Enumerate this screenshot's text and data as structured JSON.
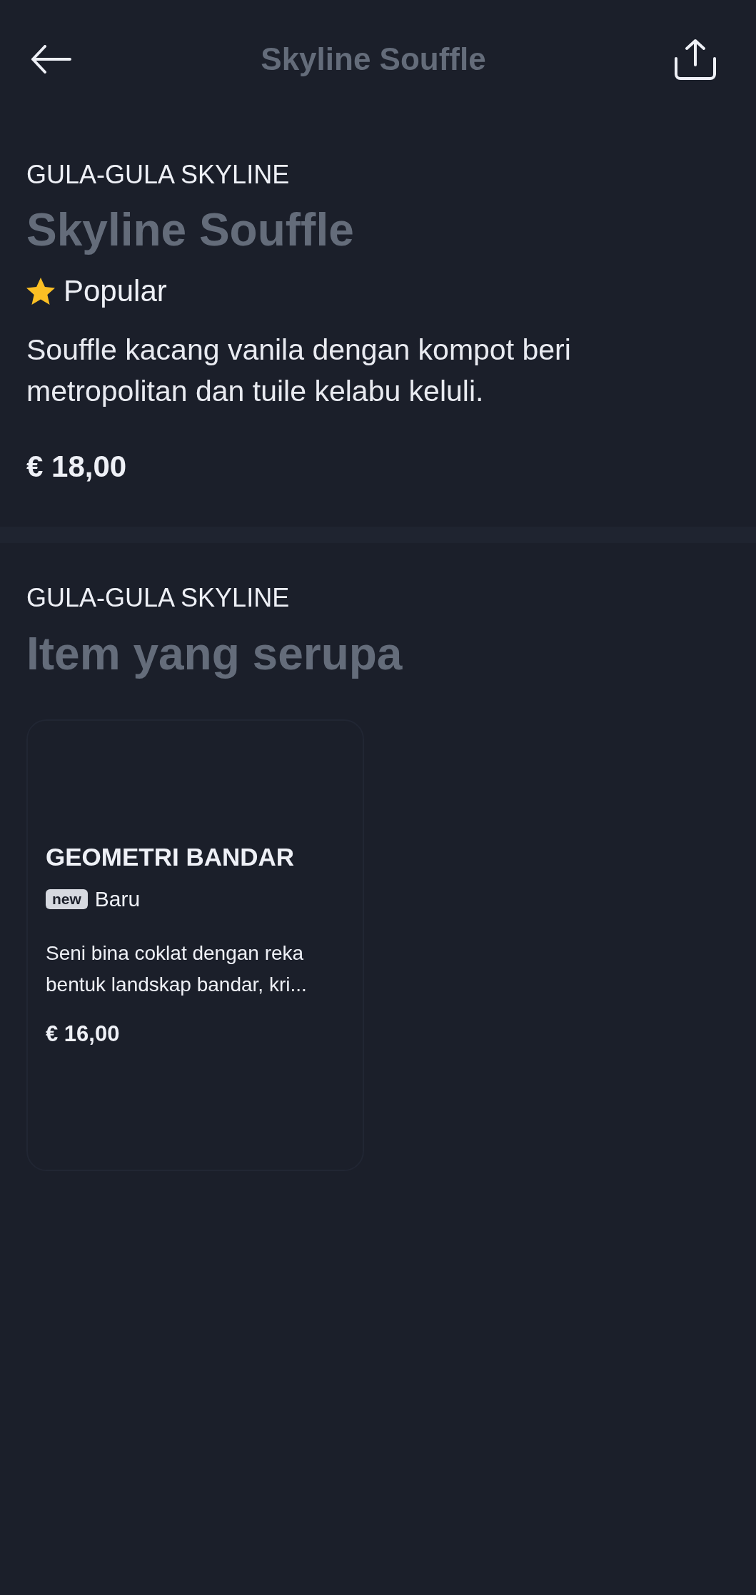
{
  "header": {
    "title": "Skyline Souffle"
  },
  "product": {
    "category": "GULA-GULA SKYLINE",
    "name": "Skyline Souffle",
    "badge": {
      "kind": "star",
      "label": "Popular"
    },
    "description": "Souffle kacang vanila dengan kompot beri metropolitan dan tuile kelabu keluli.",
    "price": "€ 18,00"
  },
  "similar": {
    "category": "GULA-GULA SKYLINE",
    "title": "Item yang serupa",
    "items": [
      {
        "name": "GEOMETRI BANDAR",
        "badge": {
          "kind": "tag",
          "tag": "new",
          "label": "Baru"
        },
        "description": "Seni bina coklat dengan reka bentuk landskap bandar, kri...",
        "price": "€ 16,00"
      }
    ]
  }
}
